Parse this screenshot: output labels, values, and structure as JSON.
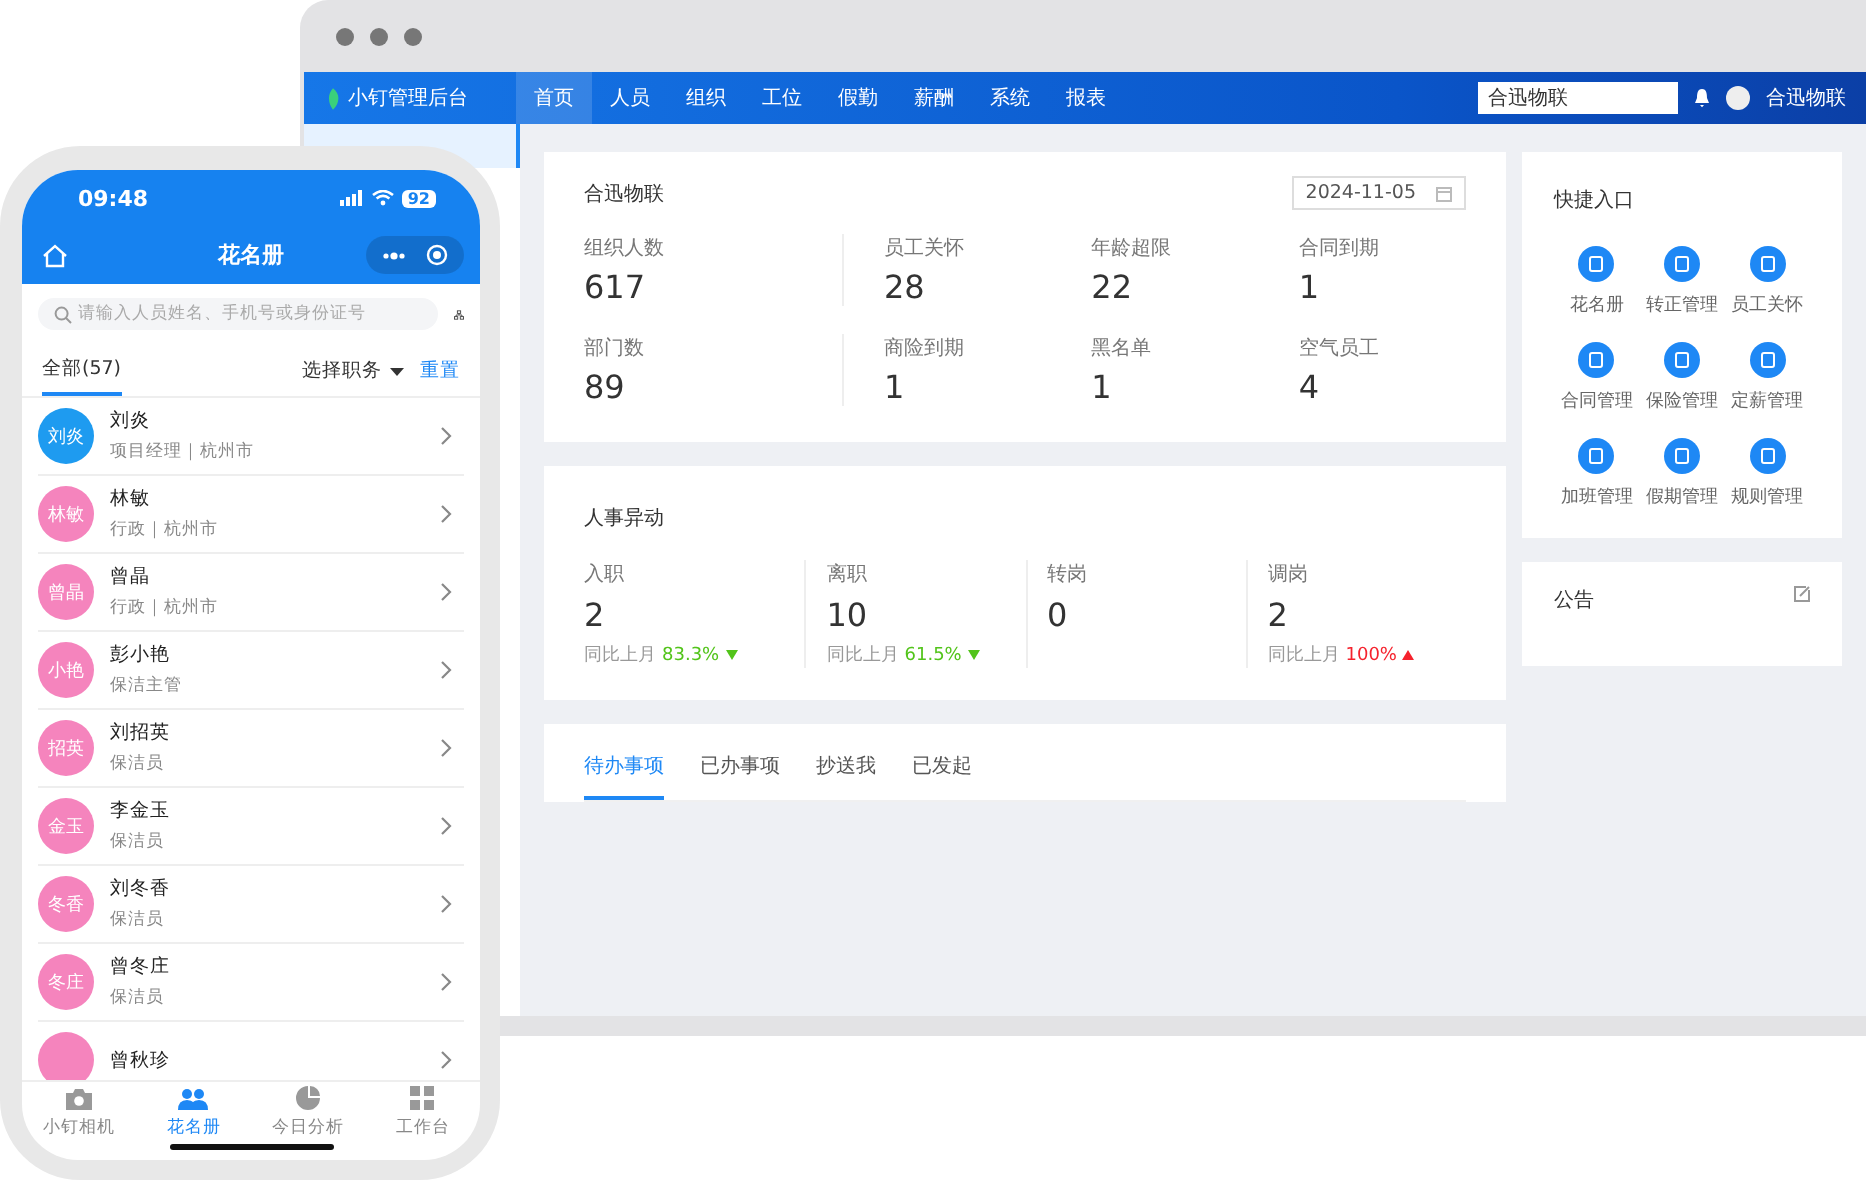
{
  "desktop": {
    "logo": "小钉管理后台",
    "nav": [
      {
        "label": "首页",
        "selected": true
      },
      {
        "label": "人员",
        "selected": false
      },
      {
        "label": "组织",
        "selected": false
      },
      {
        "label": "工位",
        "selected": false
      },
      {
        "label": "假勤",
        "selected": false
      },
      {
        "label": "薪酬",
        "selected": false
      },
      {
        "label": "系统",
        "selected": false
      },
      {
        "label": "报表",
        "selected": false
      }
    ],
    "search": {
      "value": "合迅物联"
    },
    "user": "合迅物联",
    "overview": {
      "title": "合迅物联",
      "date": "2024-11-05",
      "stats": [
        {
          "label": "组织人数",
          "value": "617"
        },
        {
          "label": "员工关怀",
          "value": "28"
        },
        {
          "label": "年龄超限",
          "value": "22"
        },
        {
          "label": "合同到期",
          "value": "1"
        },
        {
          "label": "部门数",
          "value": "89"
        },
        {
          "label": "商险到期",
          "value": "1"
        },
        {
          "label": "黑名单",
          "value": "1"
        },
        {
          "label": "空气员工",
          "value": "4"
        }
      ]
    },
    "changes": {
      "title": "人事异动",
      "items": [
        {
          "label": "入职",
          "value": "2",
          "compare": "同比上月",
          "percent": "83.3%",
          "kind": "down"
        },
        {
          "label": "离职",
          "value": "10",
          "compare": "同比上月",
          "percent": "61.5%",
          "kind": "down"
        },
        {
          "label": "转岗",
          "value": "0"
        },
        {
          "label": "调岗",
          "value": "2",
          "compare": "同比上月",
          "percent": "100%",
          "kind": "up"
        }
      ]
    },
    "tasks": {
      "tabs": [
        {
          "label": "待办事项",
          "selected": true
        },
        {
          "label": "已办事项",
          "selected": false
        },
        {
          "label": "抄送我",
          "selected": false
        },
        {
          "label": "已发起",
          "selected": false
        }
      ]
    },
    "quick": {
      "title": "快捷入口",
      "items": [
        "花名册",
        "转正管理",
        "员工关怀",
        "合同管理",
        "保险管理",
        "定薪管理",
        "加班管理",
        "假期管理",
        "规则管理"
      ]
    },
    "notice": {
      "title": "公告"
    }
  },
  "phone": {
    "time": "09:48",
    "battery": "92",
    "title": "花名册",
    "search": {
      "placeholder": "请输入人员姓名、手机号或身份证号"
    },
    "filter": {
      "tab": "全部(57)",
      "select": "选择职务",
      "reset": "重置"
    },
    "people": [
      {
        "avatar": "刘炎",
        "name": "刘炎",
        "info": "项目经理｜杭州市",
        "color": "#1e9bf0"
      },
      {
        "avatar": "林敏",
        "name": "林敏",
        "info": "行政｜杭州市",
        "color": "#f584bd"
      },
      {
        "avatar": "曾晶",
        "name": "曾晶",
        "info": "行政｜杭州市",
        "color": "#f584bd"
      },
      {
        "avatar": "小艳",
        "name": "彭小艳",
        "info": "保洁主管",
        "color": "#f584bd"
      },
      {
        "avatar": "招英",
        "name": "刘招英",
        "info": "保洁员",
        "color": "#f584bd"
      },
      {
        "avatar": "金玉",
        "name": "李金玉",
        "info": "保洁员",
        "color": "#f584bd"
      },
      {
        "avatar": "冬香",
        "name": "刘冬香",
        "info": "保洁员",
        "color": "#f584bd"
      },
      {
        "avatar": "冬庄",
        "name": "曾冬庄",
        "info": "保洁员",
        "color": "#f584bd"
      },
      {
        "name": "曾秋珍",
        "color": "#f584bd"
      }
    ],
    "tabbar": [
      {
        "label": "小钉相机",
        "kind": "camera",
        "selected": false
      },
      {
        "label": "花名册",
        "kind": "people",
        "selected": true
      },
      {
        "label": "今日分析",
        "kind": "chart",
        "selected": false
      },
      {
        "label": "工作台",
        "kind": "grid",
        "selected": false
      }
    ]
  }
}
